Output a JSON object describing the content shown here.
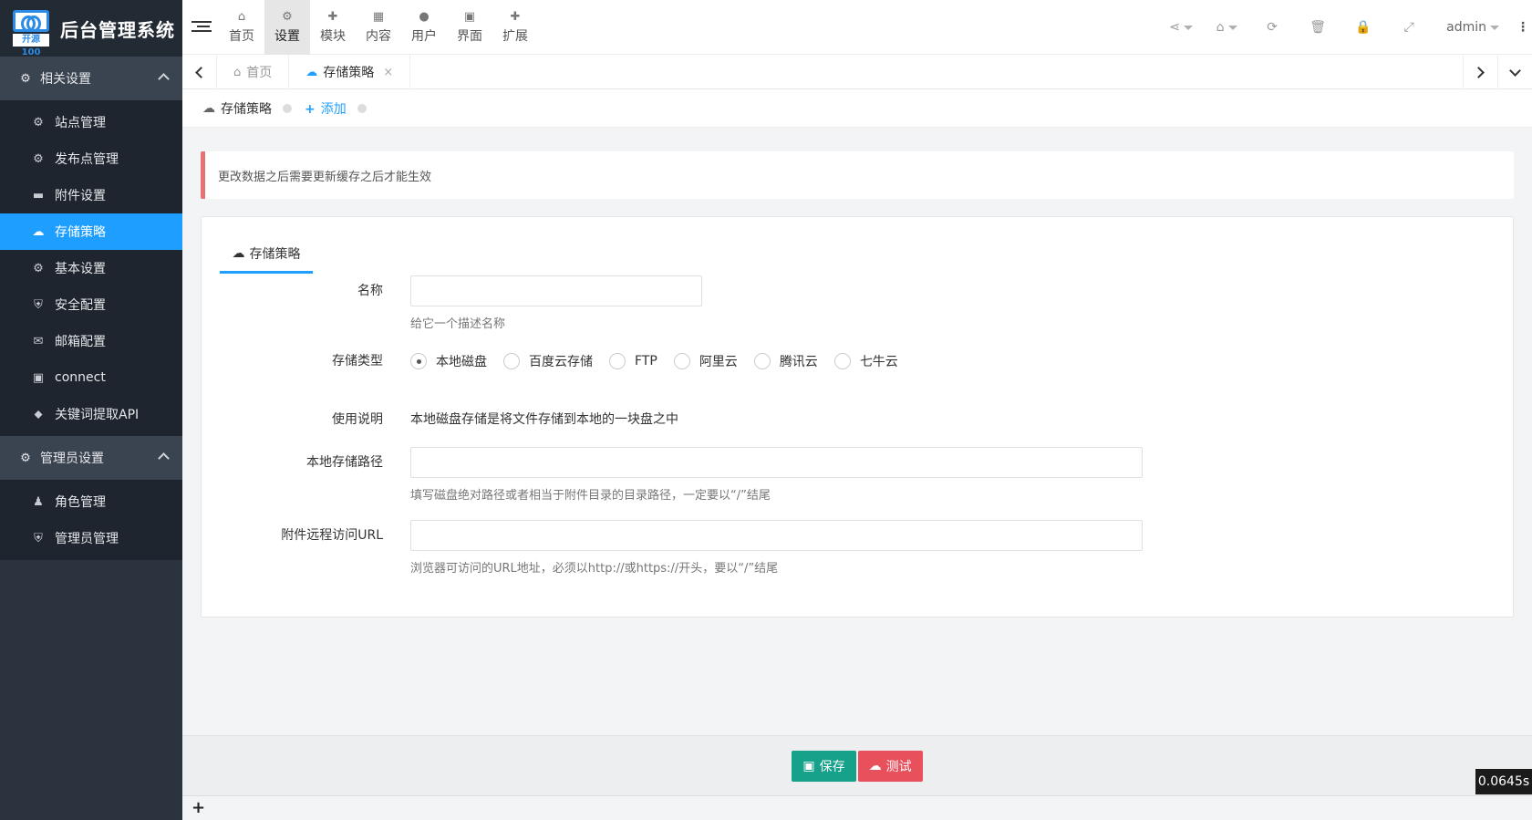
{
  "brand": {
    "logo_text": "开源100",
    "title": "后台管理系统"
  },
  "topnav": [
    {
      "icon": "home-icon",
      "glyph": "⌂",
      "label": "首页"
    },
    {
      "icon": "gears-icon",
      "glyph": "⚙",
      "label": "设置",
      "active": true
    },
    {
      "icon": "puzzle-icon",
      "glyph": "✚",
      "label": "模块"
    },
    {
      "icon": "grid-icon",
      "glyph": "▦",
      "label": "内容"
    },
    {
      "icon": "user-icon",
      "glyph": "●",
      "label": "用户"
    },
    {
      "icon": "html5-icon",
      "glyph": "▣",
      "label": "界面"
    },
    {
      "icon": "puzzle-icon",
      "glyph": "✚",
      "label": "扩展"
    }
  ],
  "toolbar": {
    "share_glyph": "⋖",
    "home_glyph": "⌂",
    "refresh_glyph": "⟳",
    "trash_glyph": "🗑",
    "lock_glyph": "🔒",
    "fullscreen_glyph": "⤢",
    "user": "admin",
    "more_glyph": "⋮"
  },
  "sidebar": {
    "groups": [
      {
        "label": "相关设置",
        "icon": "gears-icon",
        "glyph": "⚙",
        "items": [
          {
            "label": "站点管理",
            "icon": "gear-icon",
            "glyph": "⚙"
          },
          {
            "label": "发布点管理",
            "icon": "gears-icon",
            "glyph": "⚙"
          },
          {
            "label": "附件设置",
            "icon": "folder-icon",
            "glyph": "▬"
          },
          {
            "label": "存储策略",
            "icon": "cloud-icon",
            "glyph": "☁",
            "active": true
          },
          {
            "label": "基本设置",
            "icon": "gear-icon",
            "glyph": "⚙"
          },
          {
            "label": "安全配置",
            "icon": "shield-icon",
            "glyph": "⛨"
          },
          {
            "label": "邮箱配置",
            "icon": "envelope-icon",
            "glyph": "✉"
          },
          {
            "label": "connect",
            "icon": "html5-icon",
            "glyph": "▣"
          },
          {
            "label": "关键词提取API",
            "icon": "tags-icon",
            "glyph": "⬥"
          }
        ]
      },
      {
        "label": "管理员设置",
        "icon": "gear-icon",
        "glyph": "⚙",
        "items": [
          {
            "label": "角色管理",
            "icon": "users-icon",
            "glyph": "♟"
          },
          {
            "label": "管理员管理",
            "icon": "shield-icon",
            "glyph": "⛨"
          }
        ]
      }
    ]
  },
  "tabs": [
    {
      "label": "首页",
      "icon": "home-icon",
      "glyph": "⌂"
    },
    {
      "label": "存储策略",
      "icon": "cloud-icon",
      "glyph": "☁",
      "active": true,
      "close": "×"
    }
  ],
  "subnav": {
    "current": "存储策略",
    "cloud_glyph": "☁",
    "add_label": "添加",
    "add_glyph": "+"
  },
  "notice": "更改数据之后需要更新缓存之后才能生效",
  "panel": {
    "tab_label": "存储策略",
    "tab_glyph": "☁",
    "name": {
      "label": "名称",
      "value": "",
      "help": "给它一个描述名称"
    },
    "storage_type": {
      "label": "存储类型",
      "options": [
        "本地磁盘",
        "百度云存储",
        "FTP",
        "阿里云",
        "腾讯云",
        "七牛云"
      ],
      "selected": "本地磁盘"
    },
    "usage": {
      "label": "使用说明",
      "value": "本地磁盘存储是将文件存储到本地的一块盘之中"
    },
    "local_path": {
      "label": "本地存储路径",
      "value": "",
      "help": "填写磁盘绝对路径或者相当于附件目录的目录路径，一定要以“/”结尾"
    },
    "remote_url": {
      "label": "附件远程访问URL",
      "value": "",
      "help": "浏览器可访问的URL地址，必须以http://或https://开头，要以“/”结尾"
    }
  },
  "footer": {
    "save_label": "保存",
    "save_glyph": "▣",
    "test_label": "测试",
    "test_glyph": "☁"
  },
  "bottom": {
    "plus": "+"
  },
  "timer": "0.0645s",
  "colors": {
    "accent": "#1e9fff",
    "save": "#16a18a",
    "test": "#e8505b",
    "sidebar": "#2b333e"
  }
}
